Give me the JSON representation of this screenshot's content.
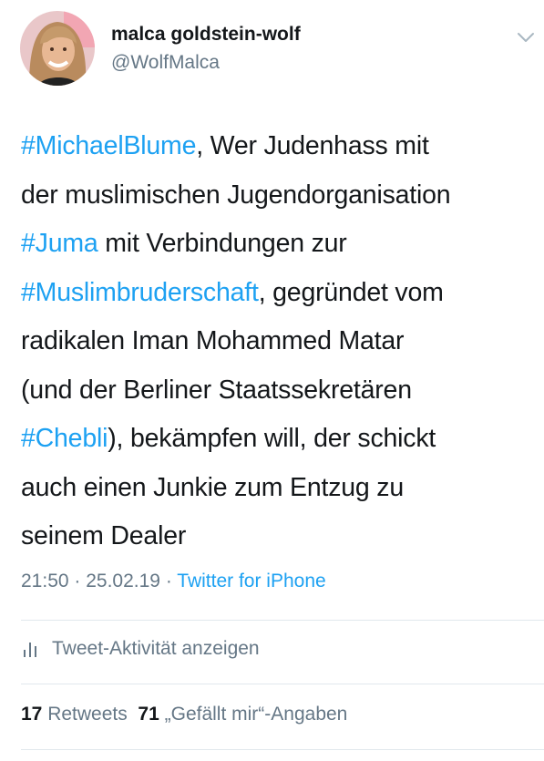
{
  "user": {
    "display_name": "malca goldstein-wolf",
    "handle": "@WolfMalca"
  },
  "tweet": {
    "lines": [
      [
        {
          "text": "#MichaelBlume",
          "tag": true
        },
        {
          "text": ", Wer Judenhass mit",
          "tag": false
        }
      ],
      [
        {
          "text": "der muslimischen Jugendorganisation",
          "tag": false
        }
      ],
      [
        {
          "text": "#Juma",
          "tag": true
        },
        {
          "text": " mit Verbindungen zur",
          "tag": false
        }
      ],
      [
        {
          "text": "#Muslimbruderschaft",
          "tag": true
        },
        {
          "text": ", gegründet vom",
          "tag": false
        }
      ],
      [
        {
          "text": "radikalen Iman Mohammed Matar",
          "tag": false
        }
      ],
      [
        {
          "text": "(und der Berliner Staatssekretären",
          "tag": false
        }
      ],
      [
        {
          "text": "#Chebli",
          "tag": true
        },
        {
          "text": "), bekämpfen will, der schickt",
          "tag": false
        }
      ],
      [
        {
          "text": "auch einen Junkie zum Entzug zu",
          "tag": false
        }
      ],
      [
        {
          "text": "seinem Dealer",
          "tag": false
        }
      ]
    ]
  },
  "meta": {
    "time": "21:50",
    "sep1": " · ",
    "date": "25.02.19",
    "sep2": " · ",
    "source": "Twitter for iPhone"
  },
  "activity": {
    "label": "Tweet-Aktivität anzeigen",
    "icon": "bar-chart-icon"
  },
  "stats": {
    "retweets_count": "17",
    "retweets_label": "Retweets",
    "likes_count": "71",
    "likes_label": "„Gefällt mir“-Angaben"
  },
  "colors": {
    "link": "#1da1f2",
    "secondary": "#657786",
    "divider": "#e1e8ed"
  },
  "icons": {
    "menu": "chevron-down-icon",
    "avatar": "avatar"
  }
}
